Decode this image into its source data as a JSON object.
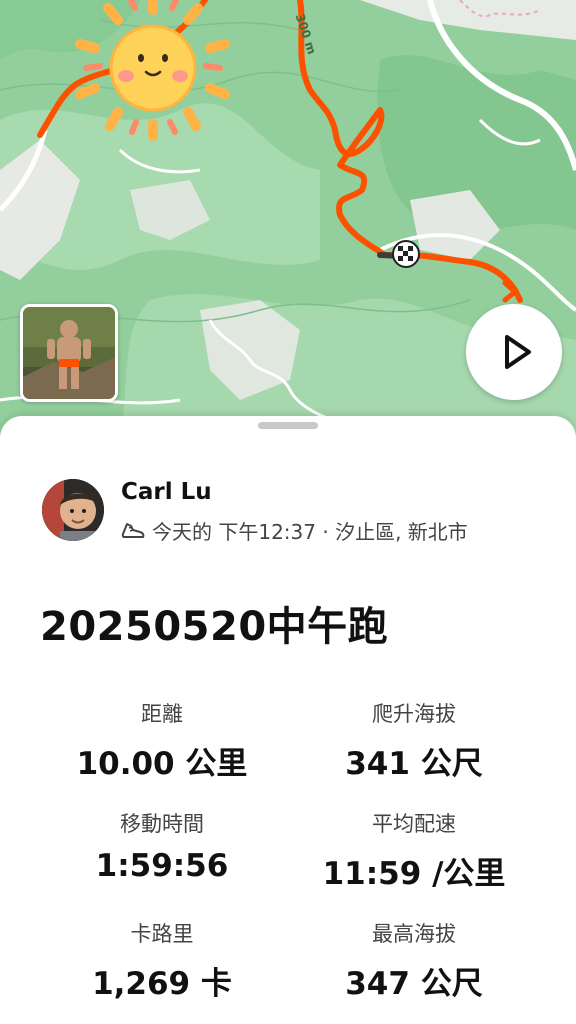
{
  "map": {
    "elevation_label": "300 m",
    "route_color": "#fc5200",
    "sticker": "sun-sticker",
    "play_icon": "play-icon"
  },
  "activity": {
    "athlete_name": "Carl Lu",
    "meta_icon": "running-shoe-icon",
    "meta_text": "今天的 下午12:37 · 汐止區, 新北市",
    "title": "20250520中午跑"
  },
  "stats": [
    {
      "label": "距離",
      "value": "10.00 公里"
    },
    {
      "label": "爬升海拔",
      "value": "341 公尺"
    },
    {
      "label": "移動時間",
      "value": "1:59:56"
    },
    {
      "label": "平均配速",
      "value": "11:59 /公里"
    },
    {
      "label": "卡路里",
      "value": "1,269 卡"
    },
    {
      "label": "最高海拔",
      "value": "347 公尺"
    }
  ]
}
